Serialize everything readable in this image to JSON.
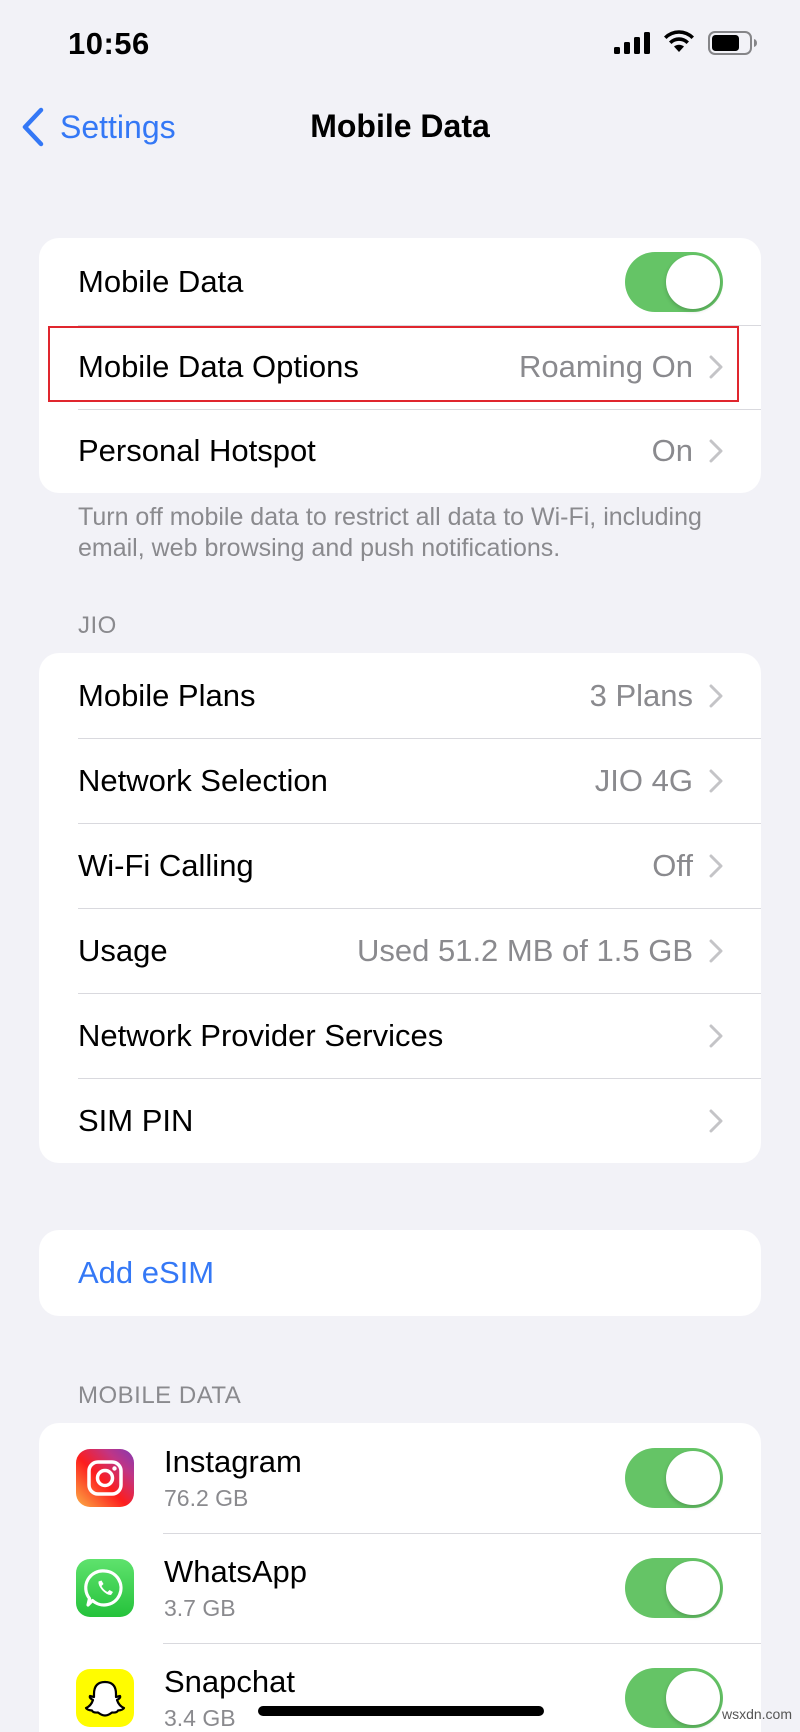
{
  "status_bar": {
    "time": "10:56"
  },
  "nav": {
    "back_label": "Settings",
    "title": "Mobile Data"
  },
  "group1": {
    "mobile_data": {
      "label": "Mobile Data",
      "enabled": true
    },
    "options": {
      "label": "Mobile Data Options",
      "value": "Roaming On"
    },
    "hotspot": {
      "label": "Personal Hotspot",
      "value": "On"
    }
  },
  "footnote": "Turn off mobile data to restrict all data to Wi-Fi, including email, web browsing and push notifications.",
  "carrier_section": {
    "header": "JIO",
    "rows": [
      {
        "label": "Mobile Plans",
        "value": "3 Plans"
      },
      {
        "label": "Network Selection",
        "value": "JIO 4G"
      },
      {
        "label": "Wi-Fi Calling",
        "value": "Off"
      },
      {
        "label": "Usage",
        "value": "Used 51.2 MB of 1.5 GB"
      },
      {
        "label": "Network Provider Services",
        "value": ""
      },
      {
        "label": "SIM PIN",
        "value": ""
      }
    ]
  },
  "esim": {
    "label": "Add eSIM"
  },
  "apps_section": {
    "header": "MOBILE DATA",
    "apps": [
      {
        "name": "Instagram",
        "size": "76.2 GB",
        "enabled": true,
        "icon": "instagram-icon"
      },
      {
        "name": "WhatsApp",
        "size": "3.7 GB",
        "enabled": true,
        "icon": "whatsapp-icon"
      },
      {
        "name": "Snapchat",
        "size": "3.4 GB",
        "enabled": true,
        "icon": "snapchat-icon"
      }
    ]
  },
  "watermark": "wsxdn.com",
  "colors": {
    "accent": "#3478f6",
    "toggle_on": "#65c466",
    "highlight": "#e0262e",
    "background": "#f2f2f7"
  }
}
